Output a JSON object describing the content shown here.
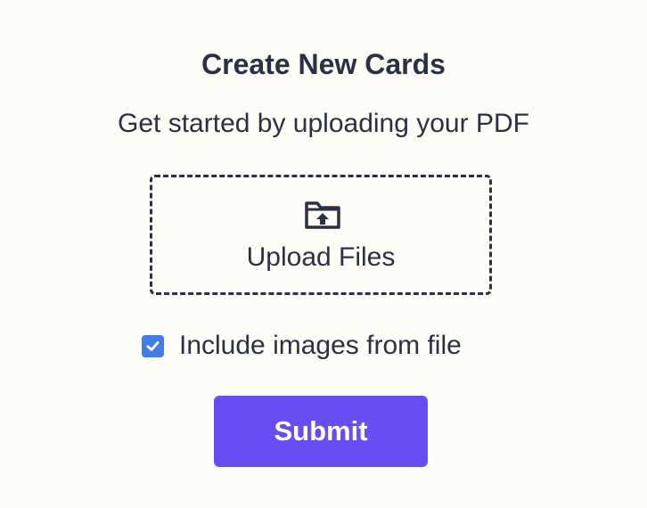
{
  "form": {
    "title": "Create New Cards",
    "subtitle": "Get started by uploading your PDF",
    "upload": {
      "icon": "folder-upload-icon",
      "label": "Upload Files"
    },
    "include_images": {
      "label": "Include images from file",
      "checked": true
    },
    "submit_label": "Submit"
  },
  "colors": {
    "background": "#fdfcf7",
    "text": "#2a3142",
    "checkbox": "#3f7ee8",
    "submit": "#6a4cf5"
  }
}
